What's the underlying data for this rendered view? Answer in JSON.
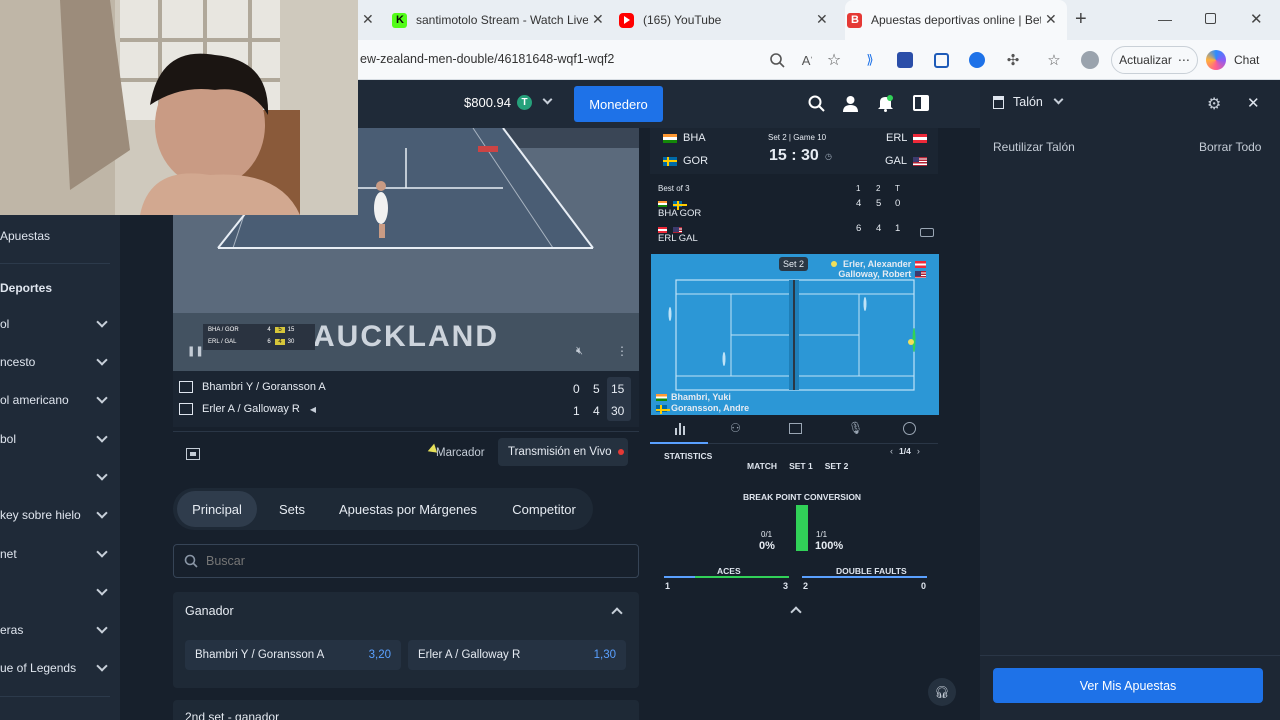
{
  "browser": {
    "tabs": [
      {
        "title": "santimotolo Stream - Watch Live",
        "icon": "kick-icon",
        "color": "#53fc18"
      },
      {
        "title": "(165) YouTube",
        "icon": "youtube-icon",
        "color": "#ff0000"
      },
      {
        "title": "Apuestas deportivas online | Bet",
        "icon": "betsite-icon",
        "color": "#e53935"
      }
    ],
    "url": "ew-zealand-men-double/46181648-wqf1-wqf2",
    "update_label": "Actualizar",
    "chat_label": "Chat"
  },
  "header": {
    "balance": "$800.94",
    "wallet_label": "Monedero"
  },
  "sidebar": {
    "apuestas_label": "Apuestas",
    "deportes_label": "Deportes",
    "items": [
      "ol",
      "ncesto",
      "ol americano",
      "bol",
      "",
      "key sobre hielo",
      "net",
      "",
      "eras",
      "ue of Legends"
    ]
  },
  "video": {
    "overlay_text": "AUCKLAND",
    "mini_score": [
      {
        "team": "BHA / GOR",
        "sets": "4",
        "games": "5",
        "pts": "15"
      },
      {
        "team": "ERL / GAL",
        "sets": "6",
        "games": "4",
        "pts": "30"
      }
    ]
  },
  "score_rows": [
    {
      "team": "Bhambri Y / Goransson A",
      "s1": "0",
      "s2": "5",
      "pts": "15"
    },
    {
      "team": "Erler A / Galloway R",
      "s1": "1",
      "s2": "4",
      "pts": "30"
    }
  ],
  "view_toggle": {
    "marcador": "Marcador",
    "live": "Transmisión en Vivo"
  },
  "market_tabs": [
    "Principal",
    "Sets",
    "Apuestas por Márgenes",
    "Competitor"
  ],
  "search": {
    "placeholder": "Buscar"
  },
  "market": {
    "title": "Ganador",
    "outcomes": [
      {
        "name": "Bhambri Y / Goransson A",
        "odds": "3,20"
      },
      {
        "name": "Erler A / Galloway R",
        "odds": "1,30"
      }
    ],
    "next_title": "2nd set - ganador"
  },
  "scoreboard": {
    "home_top": "BHA",
    "home_bottom": "GOR",
    "away_top": "ERL",
    "away_bottom": "GAL",
    "set_game": "Set 2 | Game 10",
    "clock": "15 : 30",
    "best_of": "Best of 3",
    "cols": [
      "1",
      "2",
      "T"
    ],
    "rows": [
      {
        "name": "BHA GOR",
        "vals": [
          "4",
          "5",
          "0"
        ]
      },
      {
        "name": "ERL GAL",
        "vals": [
          "6",
          "4",
          "1"
        ]
      }
    ]
  },
  "court": {
    "set_label": "Set 2",
    "top_players": [
      "Erler, Alexander",
      "Galloway, Robert"
    ],
    "bottom_players": [
      "Bhambri, Yuki",
      "Goransson, Andre"
    ]
  },
  "statistics": {
    "title": "STATISTICS",
    "pager": "1/4",
    "filters": [
      "MATCH",
      "SET 1",
      "SET 2"
    ],
    "bpc_title": "BREAK POINT CONVERSION",
    "bpc_left_frac": "0/1",
    "bpc_left_pct": "0%",
    "bpc_right_frac": "1/1",
    "bpc_right_pct": "100%",
    "bpc_left_value": 0,
    "bpc_right_value": 1,
    "aces_label": "ACES",
    "aces_left": "1",
    "aces_right": "3",
    "df_label": "DOUBLE FAULTS",
    "df_left": "2",
    "df_right": "0"
  },
  "betslip": {
    "title": "Talón",
    "reuse_label": "Reutilizar Talón",
    "clear_label": "Borrar Todo",
    "cta_label": "Ver Mis Apuestas"
  },
  "colors": {
    "accent": "#1e72e8",
    "positive": "#31d158",
    "odds": "#5aa0ff"
  }
}
